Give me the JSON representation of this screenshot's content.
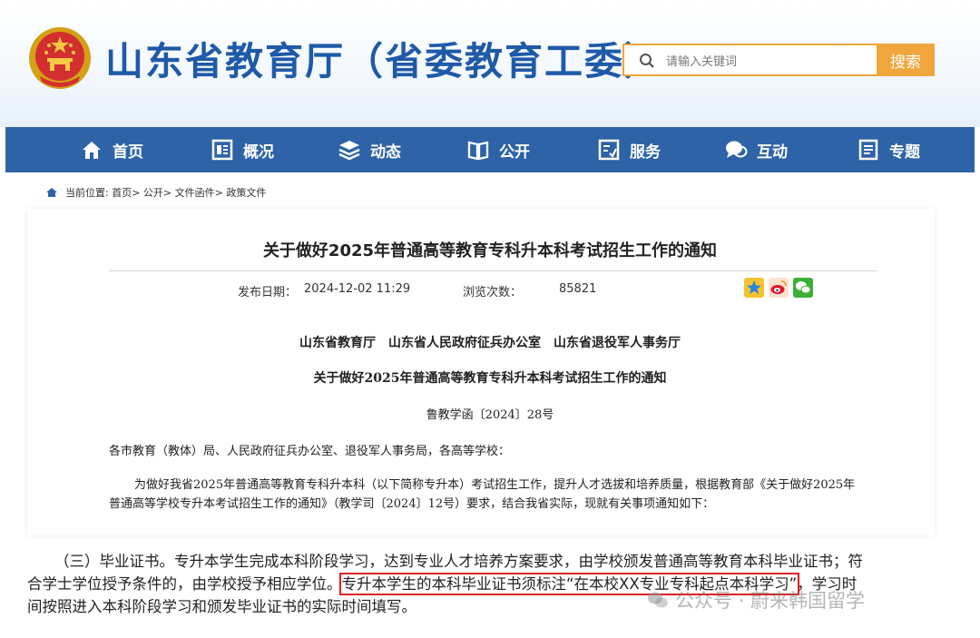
{
  "header": {
    "site_title": "山东省教育厅（省委教育工委）",
    "search_placeholder": "请输入关键词",
    "search_button": "搜索"
  },
  "nav": [
    {
      "label": "首页",
      "icon": "home-icon"
    },
    {
      "label": "概况",
      "icon": "overview-icon"
    },
    {
      "label": "动态",
      "icon": "news-icon"
    },
    {
      "label": "公开",
      "icon": "book-icon"
    },
    {
      "label": "服务",
      "icon": "service-icon"
    },
    {
      "label": "互动",
      "icon": "chat-icon"
    },
    {
      "label": "专题",
      "icon": "topic-icon"
    }
  ],
  "breadcrumb": "当前位置: 首页> 公开> 文件函件> 政策文件",
  "article": {
    "title": "关于做好2025年普通高等教育专科升本科考试招生工作的通知",
    "date_label": "发布日期：",
    "date": "2024-12-02 11:29",
    "views_label": "浏览次数：",
    "views": "85821",
    "issuers": "山东省教育厅　山东省人民政府征兵办公室　山东省退役军人事务厅",
    "doc_title": "关于做好2025年普通高等教育专科升本科考试招生工作的通知",
    "doc_number": "鲁教学函〔2024〕28号",
    "recipients": "各市教育（教体）局、人民政府征兵办公室、退役军人事务局，各高等学校：",
    "paragraph": "为做好我省2025年普通高等教育专科升本科（以下简称专升本）考试招生工作，提升人才选拔和培养质量，根据教育部《关于做好2025年普通高等学校专升本考试招生工作的通知》（教学司〔2024〕12号）要求，结合我省实际，现就有关事项通知如下："
  },
  "excerpt": {
    "line1": "（三）毕业证书。专升本学生完成本科阶段学习，达到专业人才培养方案要求，由学校颁发普通高等教育本科毕业证书；符",
    "line2_pre": "合学士学位授予条件的，由学校授予相应学位。",
    "line2_highlight": "专升本学生的本科毕业证书须标注“在本校XX专业专科起点本科学习”",
    "line2_post": "，学习时",
    "line3": "间按照进入本科阶段学习和颁发毕业证书的实际时间填写。"
  },
  "watermark": "公众号 · 蔚来韩国留学",
  "colors": {
    "brand_blue": "#2e63a8",
    "title_blue": "#1f5aa8",
    "accent_orange": "#f0a63c",
    "highlight_red": "#e02020"
  }
}
